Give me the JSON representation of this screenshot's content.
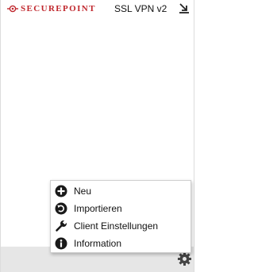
{
  "header": {
    "brand": "SECUREPOINT",
    "product": "SSL VPN v2",
    "brand_color": "#c0272d",
    "logo_icon": "securepoint-logo-icon",
    "minimize_icon": "minimize-to-tray-icon"
  },
  "menu": {
    "items": [
      {
        "label": "Neu",
        "icon": "plus-circle-icon"
      },
      {
        "label": "Importieren",
        "icon": "import-icon"
      },
      {
        "label": "Client Einstellungen",
        "icon": "wrench-icon"
      },
      {
        "label": "Information",
        "icon": "info-icon"
      }
    ]
  },
  "footer": {
    "settings_icon": "gear-icon"
  }
}
